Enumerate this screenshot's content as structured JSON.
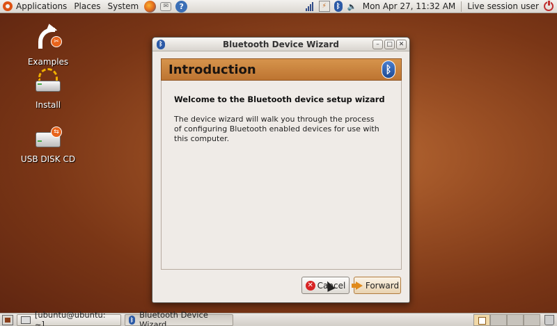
{
  "top_panel": {
    "menus": [
      "Applications",
      "Places",
      "System"
    ],
    "launchers": [
      "firefox-icon",
      "mail-icon",
      "help-icon"
    ],
    "clock": "Mon Apr 27, 11:32 AM",
    "session": "Live session user"
  },
  "desktop_icons": [
    {
      "label": "Examples"
    },
    {
      "label": "Install"
    },
    {
      "label": "USB DISK CD"
    }
  ],
  "window": {
    "title": "Bluetooth Device Wizard",
    "page_title": "Introduction",
    "welcome": "Welcome to the Bluetooth device setup wizard",
    "description": "The device wizard will walk you through the process of configuring Bluetooth enabled devices for use with this computer.",
    "cancel_label": "Cancel",
    "forward_label": "Forward"
  },
  "taskbar": {
    "items": [
      {
        "label": "[ubuntu@ubuntu: ~]",
        "active": false
      },
      {
        "label": "Bluetooth Device Wizard",
        "active": true
      }
    ]
  },
  "colors": {
    "desktop": "#8a4420",
    "header_band": "#c98040",
    "bluetooth": "#2c5aa6"
  }
}
